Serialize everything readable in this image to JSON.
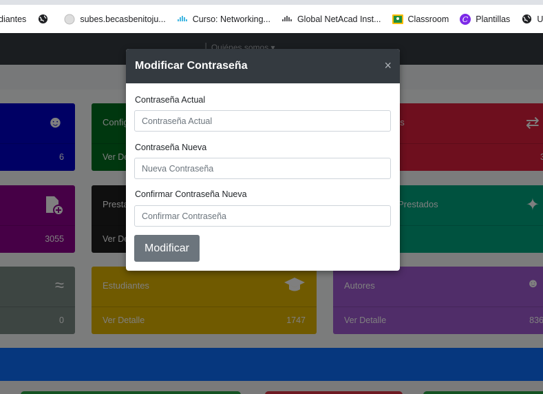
{
  "bookmarks": [
    {
      "label": "diantes",
      "icon": ""
    },
    {
      "label": "",
      "icon": "globe-icon"
    },
    {
      "label": "subes.becasbenitoju...",
      "icon": "site-icon"
    },
    {
      "label": "Curso: Networking...",
      "icon": "cisco-icon"
    },
    {
      "label": "Global NetAcad Inst...",
      "icon": "cisco-icon"
    },
    {
      "label": "Classroom",
      "icon": "classroom-icon"
    },
    {
      "label": "Plantillas",
      "icon": "canva-icon"
    },
    {
      "label": "UTPARR",
      "icon": "globe-icon"
    }
  ],
  "navbar": {
    "text": "│ Quiénes somos ▾"
  },
  "cards": [
    {
      "id": "blue",
      "color": "#0000c8",
      "title": "",
      "link": "",
      "number": "6",
      "icon": "user-icon",
      "glyph": "☻"
    },
    {
      "id": "green",
      "color": "#006e1f",
      "title": "Config",
      "link": "Ver De",
      "number": "",
      "icon": "",
      "glyph": ""
    },
    {
      "id": "red",
      "color": "#dc1e3c",
      "title": "es",
      "link": "",
      "number": "3",
      "icon": "exchange-icon",
      "glyph": "⇄"
    },
    {
      "id": "purple",
      "color": "#8c008c",
      "title": "",
      "link": "",
      "number": "3055",
      "icon": "file-add-icon",
      "glyph": "➕"
    },
    {
      "id": "dark",
      "color": "#1e1e1e",
      "title": "Presta",
      "link": "Ver De",
      "number": "",
      "icon": "",
      "glyph": ""
    },
    {
      "id": "teal",
      "color": "#00a57f",
      "title": "s Prestados",
      "link": "",
      "number": "",
      "icon": "handshake-icon",
      "glyph": "✦"
    },
    {
      "id": "gray",
      "color": "#7a8a84",
      "title": "",
      "link": "",
      "number": "0",
      "icon": "waves-icon",
      "glyph": "≈"
    },
    {
      "id": "yellow",
      "color": "#e0b400",
      "title": "Estudiantes",
      "link": "Ver Detalle",
      "number": "1747",
      "icon": "graduation-cap-icon",
      "glyph": "▲"
    },
    {
      "id": "violet",
      "color": "#a05ad2",
      "title": "Autores",
      "link": "Ver Detalle",
      "number": "836",
      "icon": "user-icon",
      "glyph": "☻"
    }
  ],
  "modal": {
    "title": "Modificar Contraseña",
    "close_label": "×",
    "fields": [
      {
        "label": "Contraseña Actual",
        "placeholder": "Contraseña Actual"
      },
      {
        "label": "Contraseña Nueva",
        "placeholder": "Nueva Contraseña"
      },
      {
        "label": "Confirmar Contraseña Nueva",
        "placeholder": "Confirmar Contraseña"
      }
    ],
    "submit_label": "Modificar"
  }
}
